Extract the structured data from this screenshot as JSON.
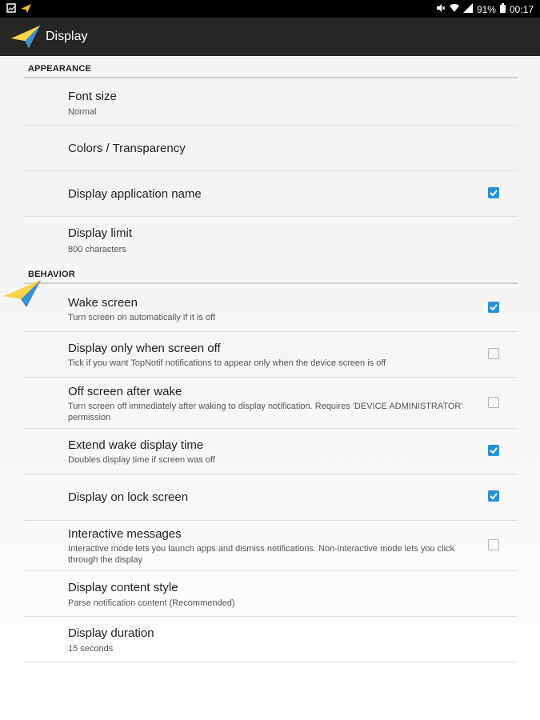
{
  "status": {
    "battery": "91%",
    "time": "00:17"
  },
  "toolbar": {
    "title": "Display"
  },
  "sections": [
    {
      "header": "APPEARANCE",
      "items": [
        {
          "title": "Font size",
          "summary": "Normal"
        },
        {
          "title": "Colors / Transparency"
        },
        {
          "title": "Display application name",
          "checked": true
        },
        {
          "title": "Display limit",
          "summary": "800 characters"
        }
      ]
    },
    {
      "header": "BEHAVIOR",
      "items": [
        {
          "title": "Wake screen",
          "summary": "Turn screen on automatically if it is off",
          "checked": true
        },
        {
          "title": "Display only when screen off",
          "summary": "Tick if you want TopNotif notifications to appear only when the device screen is off",
          "checked": false
        },
        {
          "title": "Off screen after wake",
          "summary": "Turn screen off immediately after waking to display notification. Requires 'DEVICE ADMINISTRATOR' permission",
          "checked": false
        },
        {
          "title": "Extend wake display time",
          "summary": "Doubles display time if screen was off",
          "checked": true
        },
        {
          "title": "Display on lock screen",
          "checked": true
        },
        {
          "title": "Interactive messages",
          "summary": "Interactive mode lets you launch apps and dismiss notifications. Non-interactive mode lets you click through the display",
          "checked": false
        },
        {
          "title": "Display content style",
          "summary": "Parse notification content (Recommended)"
        },
        {
          "title": "Display duration",
          "summary": "15 seconds"
        }
      ]
    }
  ],
  "colors": {
    "accent": "#2a8fd6",
    "toolbar": "#262626",
    "logo": "#f2c21b"
  },
  "icons": [
    "paper-plane-icon",
    "mute-icon",
    "wifi-icon",
    "signal-icon",
    "battery-icon"
  ]
}
